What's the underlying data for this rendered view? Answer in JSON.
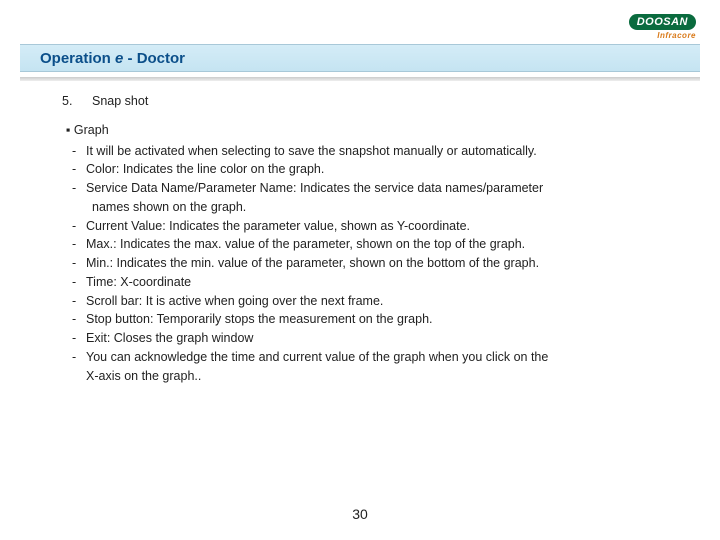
{
  "logo": {
    "main": "DOOSAN",
    "sub": "Infracore"
  },
  "title": {
    "prefix": "Operation ",
    "em": "e",
    "suffix": " - Doctor"
  },
  "section": {
    "number": "5.",
    "name": "Snap shot"
  },
  "subhead": "▪ Graph",
  "items": [
    "It will be activated when selecting to save the snapshot manually or automatically.",
    "Color: Indicates the line color on the graph.",
    "Service Data Name/Parameter Name: Indicates the service data names/parameter",
    "Current Value: Indicates the parameter value, shown as Y-coordinate.",
    "Max.: Indicates the max. value of the parameter, shown on the top of the graph.",
    "Min.: Indicates the min. value of the parameter, shown on the bottom of the graph.",
    "Time: X-coordinate",
    "Scroll bar: It is active when going over the next frame.",
    "Stop button: Temporarily stops the measurement on the graph.",
    "Exit: Closes the graph window",
    "You can acknowledge the time and current value of the graph when you click on the"
  ],
  "cont1": "names shown on the graph.",
  "cont2": "X-axis on the graph..",
  "dash": "-",
  "pageNumber": "30"
}
